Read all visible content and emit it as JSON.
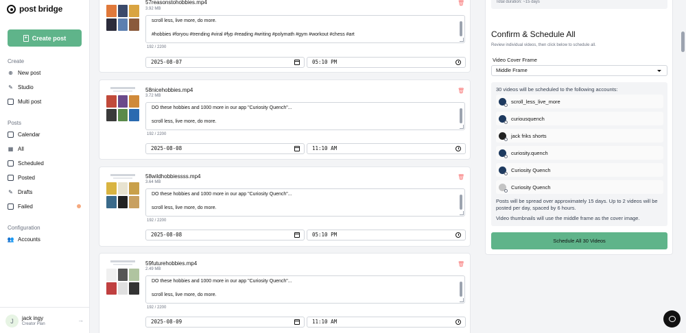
{
  "app": {
    "logo_text": "post bridge"
  },
  "sidebar": {
    "create_button": "Create post",
    "sections": {
      "create": "Create",
      "posts": "Posts",
      "configuration": "Configuration"
    },
    "create_items": [
      "New post",
      "Studio",
      "Multi post"
    ],
    "post_items": [
      "Calendar",
      "All",
      "Scheduled",
      "Posted",
      "Drafts",
      "Failed"
    ],
    "config_items": [
      "Accounts"
    ],
    "user": {
      "initial": "J",
      "name": "jack ingy",
      "plan": "Creator Plan"
    }
  },
  "videos": [
    {
      "filename": "57reasonstohobbies.mp4",
      "size": "3.92 MB",
      "caption_lines": [
        "scroll less, live more, do more.",
        "",
        "#hobbies #foryou #trending #viral #fyp #reading #writing #polymath #gym #workout #chess #art"
      ],
      "counter": "192 / 2200",
      "date": "2025-08-07",
      "time": "05:10 PM"
    },
    {
      "filename": "58nicehobbies.mp4",
      "size": "3.72 MB",
      "caption_lines": [
        "DO these hobbies and 1000 more in our app \"Curiosity Quench\"...",
        "",
        "scroll less, live more, do more."
      ],
      "counter": "192 / 2200",
      "date": "2025-08-08",
      "time": "11:10 AM"
    },
    {
      "filename": "58wildhobbiessss.mp4",
      "size": "3.64 MB",
      "caption_lines": [
        "DO these hobbies and 1000 more in our app \"Curiosity Quench\"...",
        "",
        "scroll less, live more, do more."
      ],
      "counter": "192 / 2200",
      "date": "2025-08-08",
      "time": "05:10 PM"
    },
    {
      "filename": "59futurehobbies.mp4",
      "size": "2.49 MB",
      "caption_lines": [
        "DO these hobbies and 1000 more in our app \"Curiosity Quench\"...",
        "",
        "scroll less, live more, do more."
      ],
      "counter": "192 / 2200",
      "date": "2025-08-09",
      "time": "11:10 AM"
    }
  ],
  "schedule_panel": {
    "top_text": "Total duration: ~15 days",
    "title": "Confirm & Schedule All",
    "subtitle": "Review individual videos, then click below to schedule all.",
    "cover_label": "Video Cover Frame",
    "cover_value": "Middle Frame",
    "accounts_heading": "30 videos will be scheduled to the following accounts:",
    "accounts": [
      "scroll_less_live_more",
      "curiousquench",
      "jack friks shorts",
      "curiosity.quench",
      "Curiosity Quench",
      "Curiosity Quench"
    ],
    "note_spread": "Posts will be spread over approximately 15 days. Up to 2 videos will be posted per day, spaced by 6 hours.",
    "note_thumbnails": "Video thumbnails will use the middle frame as the cover image.",
    "button": "Schedule All 30 Videos"
  },
  "colors": {
    "accent": "#5fb48a",
    "danger": "#f87171"
  }
}
